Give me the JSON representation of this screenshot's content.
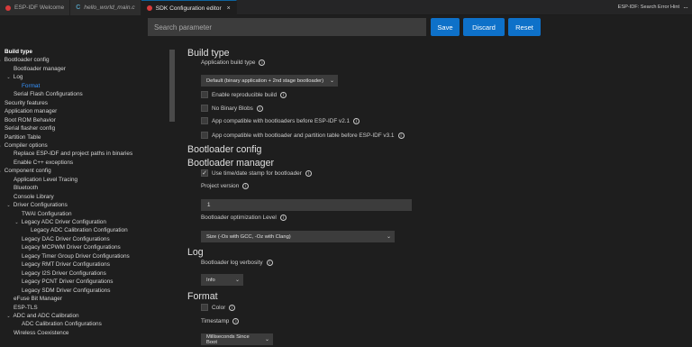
{
  "tabs": [
    {
      "label": "ESP-IDF Welcome",
      "icon": "espressif-icon",
      "active": false,
      "italic": false
    },
    {
      "label": "hello_world_main.c",
      "icon": "c-file-icon",
      "active": false,
      "italic": true
    },
    {
      "label": "SDK Configuration editor",
      "icon": "espressif-icon",
      "active": true,
      "italic": false
    }
  ],
  "tab_close_glyph": "×",
  "tab_c_glyph": "C",
  "hint": {
    "text": "ESP-IDF: Search Error Hint",
    "more": "···"
  },
  "toolbar": {
    "search_placeholder": "Search parameter",
    "save_label": "Save",
    "discard_label": "Discard",
    "reset_label": "Reset",
    "button_color": "#0e71c9"
  },
  "sidebar": {
    "items": [
      {
        "label": "Build type",
        "indent": 0,
        "chevron": "",
        "bold": true
      },
      {
        "label": "Bootloader config",
        "indent": 0,
        "chevron": "⌄"
      },
      {
        "label": "Bootloader manager",
        "indent": 1,
        "chevron": ""
      },
      {
        "label": "Log",
        "indent": 1,
        "chevron": "⌄"
      },
      {
        "label": "Format",
        "indent": 2,
        "chevron": "",
        "active": true
      },
      {
        "label": "Serial Flash Configurations",
        "indent": 1,
        "chevron": ""
      },
      {
        "label": "Security features",
        "indent": 0,
        "chevron": ""
      },
      {
        "label": "Application manager",
        "indent": 0,
        "chevron": ""
      },
      {
        "label": "Boot ROM Behavior",
        "indent": 0,
        "chevron": ""
      },
      {
        "label": "Serial flasher config",
        "indent": 0,
        "chevron": ""
      },
      {
        "label": "Partition Table",
        "indent": 0,
        "chevron": ""
      },
      {
        "label": "Compiler options",
        "indent": 0,
        "chevron": "⌄"
      },
      {
        "label": "Replace ESP-IDF and project paths in binaries",
        "indent": 1,
        "chevron": ""
      },
      {
        "label": "Enable C++ exceptions",
        "indent": 1,
        "chevron": ""
      },
      {
        "label": "Component config",
        "indent": 0,
        "chevron": "⌄"
      },
      {
        "label": "Application Level Tracing",
        "indent": 1,
        "chevron": ""
      },
      {
        "label": "Bluetooth",
        "indent": 1,
        "chevron": ""
      },
      {
        "label": "Console Library",
        "indent": 1,
        "chevron": ""
      },
      {
        "label": "Driver Configurations",
        "indent": 1,
        "chevron": "⌄"
      },
      {
        "label": "TWAI Configuration",
        "indent": 2,
        "chevron": ""
      },
      {
        "label": "Legacy ADC Driver Configuration",
        "indent": 2,
        "chevron": "⌄"
      },
      {
        "label": "Legacy ADC Calibration Configuration",
        "indent": 3,
        "chevron": ""
      },
      {
        "label": "Legacy DAC Driver Configurations",
        "indent": 2,
        "chevron": ""
      },
      {
        "label": "Legacy MCPWM Driver Configurations",
        "indent": 2,
        "chevron": ""
      },
      {
        "label": "Legacy Timer Group Driver Configurations",
        "indent": 2,
        "chevron": ""
      },
      {
        "label": "Legacy RMT Driver Configurations",
        "indent": 2,
        "chevron": ""
      },
      {
        "label": "Legacy I2S Driver Configurations",
        "indent": 2,
        "chevron": ""
      },
      {
        "label": "Legacy PCNT Driver Configurations",
        "indent": 2,
        "chevron": ""
      },
      {
        "label": "Legacy SDM Driver Configurations",
        "indent": 2,
        "chevron": ""
      },
      {
        "label": "eFuse Bit Manager",
        "indent": 1,
        "chevron": ""
      },
      {
        "label": "ESP-TLS",
        "indent": 1,
        "chevron": ""
      },
      {
        "label": "ADC and ADC Calibration",
        "indent": 1,
        "chevron": "⌄"
      },
      {
        "label": "ADC Calibration Configurations",
        "indent": 2,
        "chevron": ""
      },
      {
        "label": "Wireless Coexistence",
        "indent": 1,
        "chevron": ""
      }
    ]
  },
  "content": {
    "build_type": {
      "heading": "Build type",
      "app_build_type_label": "Application build type",
      "app_build_type_value": "Default (binary application + 2nd stage bootloader)",
      "checks": [
        {
          "label": "Enable reproducible build",
          "checked": false
        },
        {
          "label": "No Binary Blobs",
          "checked": false
        },
        {
          "label": "App compatible with bootloaders before ESP-IDF v2.1",
          "checked": false
        },
        {
          "label": "App compatible with bootloader and partition table before ESP-IDF v3.1",
          "checked": false
        }
      ]
    },
    "bootloader_config": {
      "heading": "Bootloader config"
    },
    "bootloader_manager": {
      "heading": "Bootloader manager",
      "timestamp_label": "Use time/date stamp for bootloader",
      "timestamp_checked": true,
      "project_version_label": "Project version",
      "project_version_value": "1",
      "opt_level_label": "Bootloader optimization Level",
      "opt_level_value": "Size (-Os with GCC, -Oz with Clang)"
    },
    "log": {
      "heading": "Log",
      "verbosity_label": "Bootloader log verbosity",
      "verbosity_value": "Info"
    },
    "format": {
      "heading": "Format",
      "color_label": "Color",
      "color_checked": false,
      "timestamp_label": "Timestamp",
      "timestamp_value": "Milliseconds Since Boot"
    }
  },
  "glyphs": {
    "info": "i",
    "caret": "⌄",
    "check": "✓"
  }
}
